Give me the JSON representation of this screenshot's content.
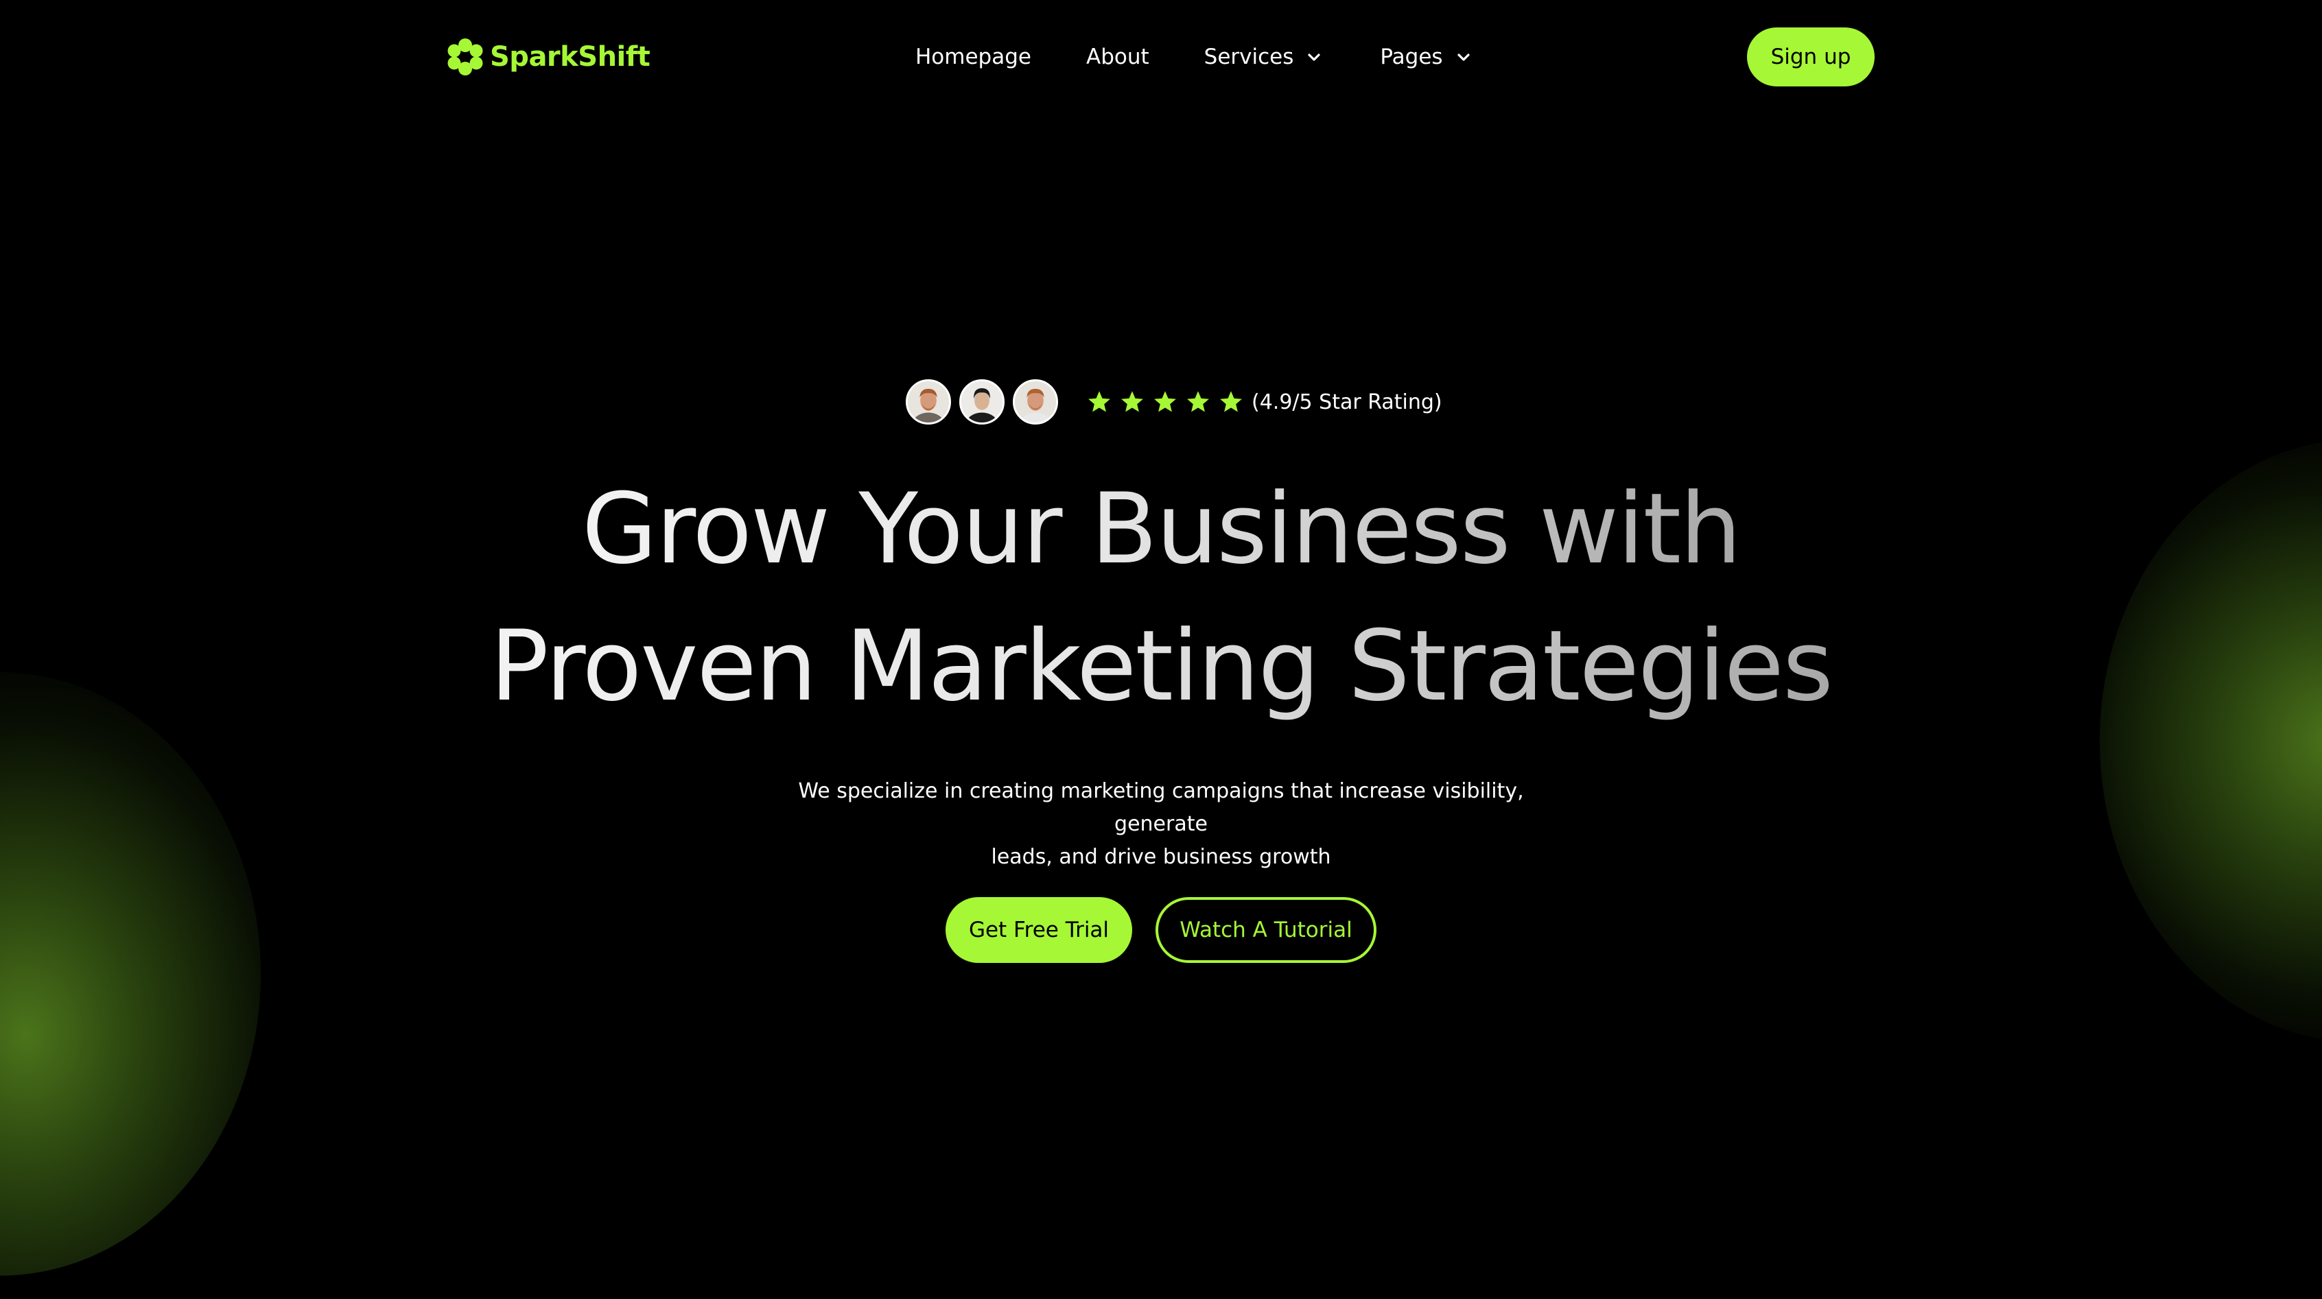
{
  "brand": {
    "name": "SparkShift",
    "accent_color": "#a6f735",
    "logo_icon": "flower-logo-icon"
  },
  "nav": {
    "items": [
      {
        "label": "Homepage",
        "has_dropdown": false
      },
      {
        "label": "About",
        "has_dropdown": false
      },
      {
        "label": "Services",
        "has_dropdown": true
      },
      {
        "label": "Pages",
        "has_dropdown": true
      }
    ],
    "signup_label": "Sign up"
  },
  "hero": {
    "avatars": [
      "avatar-person-1",
      "avatar-person-2",
      "avatar-person-3"
    ],
    "star_count": 5,
    "rating_text": "(4.9/5 Star Rating)",
    "headline_line1": "Grow Your Business with",
    "headline_line2": "Proven Marketing Strategies",
    "subtext_line1": "We specialize in creating marketing campaigns that increase visibility, generate",
    "subtext_line2": "leads, and drive business growth",
    "primary_cta": "Get Free Trial",
    "secondary_cta": "Watch A Tutorial"
  },
  "colors": {
    "background": "#000000",
    "glow": "#4f7a1c",
    "text": "#ffffff"
  }
}
